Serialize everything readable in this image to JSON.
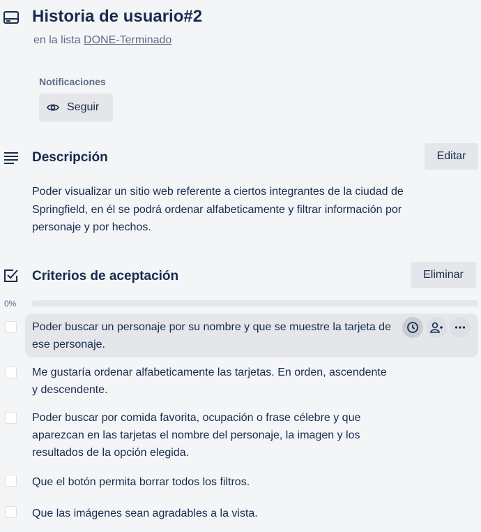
{
  "card": {
    "icon": "card-icon",
    "title": "Historia de usuario#2",
    "in_list_prefix": "en la lista ",
    "list_name": "DONE-Terminado"
  },
  "notifications": {
    "label": "Notificaciones",
    "follow_label": "Seguir",
    "follow_icon": "eye-icon"
  },
  "description": {
    "icon": "description-icon",
    "title": "Descripción",
    "edit_label": "Editar",
    "text": "Poder visualizar un sitio web referente a ciertos integrantes de la ciudad de Springfield, en él se podrá ordenar alfabeticamente y filtrar información por personaje y por hechos."
  },
  "checklist": {
    "icon": "checklist-icon",
    "title": "Criterios de aceptación",
    "delete_label": "Eliminar",
    "progress_text": "0%",
    "progress": 0,
    "items": [
      {
        "text": "Poder buscar un personaje por su nombre y que se muestre la tarjeta de ese personaje.",
        "checked": false
      },
      {
        "text": "Me gustaría ordenar alfabeticamente las tarjetas. En orden, ascendente y descendente.",
        "checked": false
      },
      {
        "text": "Poder buscar por comida favorita, ocupación o frase célebre y que aparezcan en las tarjetas el nombre del personaje, la imagen y los resultados de la opción elegida.",
        "checked": false
      },
      {
        "text": "Que el botón permita borrar todos los filtros.",
        "checked": false
      },
      {
        "text": "Que las imágenes sean agradables a la vista.",
        "checked": false
      }
    ],
    "item_actions": [
      "clock-icon",
      "add-member-icon",
      "more-icon"
    ]
  },
  "colors": {
    "background": "#f4f5f7",
    "text": "#172b4d",
    "muted": "#5e6c84",
    "button": "#e4e6ea",
    "progress": "#5aac44"
  }
}
